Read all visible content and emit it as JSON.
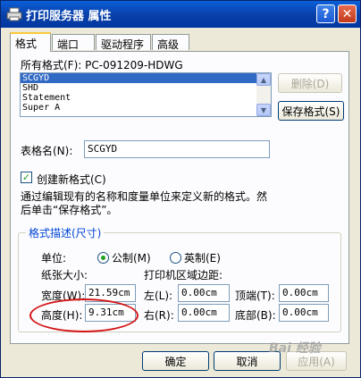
{
  "window": {
    "title": "打印服务器 属性",
    "help_glyph": "?",
    "close_glyph": "✕"
  },
  "tabs": [
    "格式",
    "端口",
    "驱动程序",
    "高级"
  ],
  "all_formats_label": "所有格式(F): PC-091209-HDWG",
  "formats_list": [
    "SCGYD",
    "SHD",
    "Statement",
    "Super A"
  ],
  "buttons": {
    "delete": "删除(D)",
    "save_format": "保存格式(S)",
    "ok": "确定",
    "cancel": "取消",
    "apply": "应用(A)"
  },
  "form_name": {
    "label": "表格名(N):",
    "value": "SCGYD"
  },
  "create_new": {
    "label": "创建新格式(C)",
    "checked": true
  },
  "description": "通过编辑现有的名称和度量单位来定义新的格式。然后单击“保存格式”。",
  "group": {
    "title": "格式描述(尺寸)",
    "unit_label": "单位:",
    "metric": "公制(M)",
    "english": "英制(E)",
    "paper_size": "纸张大小:",
    "margins": "打印机区域边距:",
    "width_label": "宽度(W):",
    "width_value": "21.59cm",
    "height_label": "高度(H):",
    "height_value": "9.31cm",
    "left_label": "左(L):",
    "left_value": "0.00cm",
    "right_label": "右(R):",
    "right_value": "0.00cm",
    "top_label": "顶端(T):",
    "top_value": "0.00cm",
    "bottom_label": "底部(B):",
    "bottom_value": "0.00cm"
  },
  "watermark": "Bai 经验"
}
